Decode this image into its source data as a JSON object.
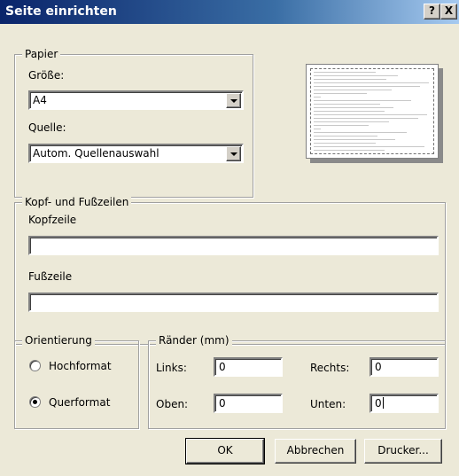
{
  "window": {
    "title": "Seite einrichten",
    "help_label": "?",
    "close_label": "X"
  },
  "paper": {
    "legend": "Papier",
    "size_label": "Größe:",
    "size_value": "A4",
    "source_label": "Quelle:",
    "source_value": "Autom. Quellenauswahl"
  },
  "headers": {
    "legend": "Kopf- und Fußzeilen",
    "header_label": "Kopfzeile",
    "header_value": "",
    "footer_label": "Fußzeile",
    "footer_value": ""
  },
  "orientation": {
    "legend": "Orientierung",
    "portrait_label": "Hochformat",
    "landscape_label": "Querformat",
    "selected": "Querformat"
  },
  "margins": {
    "legend": "Ränder (mm)",
    "left_label": "Links:",
    "left_value": "0",
    "right_label": "Rechts:",
    "right_value": "0",
    "top_label": "Oben:",
    "top_value": "0",
    "bottom_label": "Unten:",
    "bottom_value": "0"
  },
  "buttons": {
    "ok": "OK",
    "cancel": "Abbrechen",
    "printer": "Drucker..."
  },
  "colors": {
    "titlebar": "#0a246a",
    "face": "#ece9d8"
  }
}
